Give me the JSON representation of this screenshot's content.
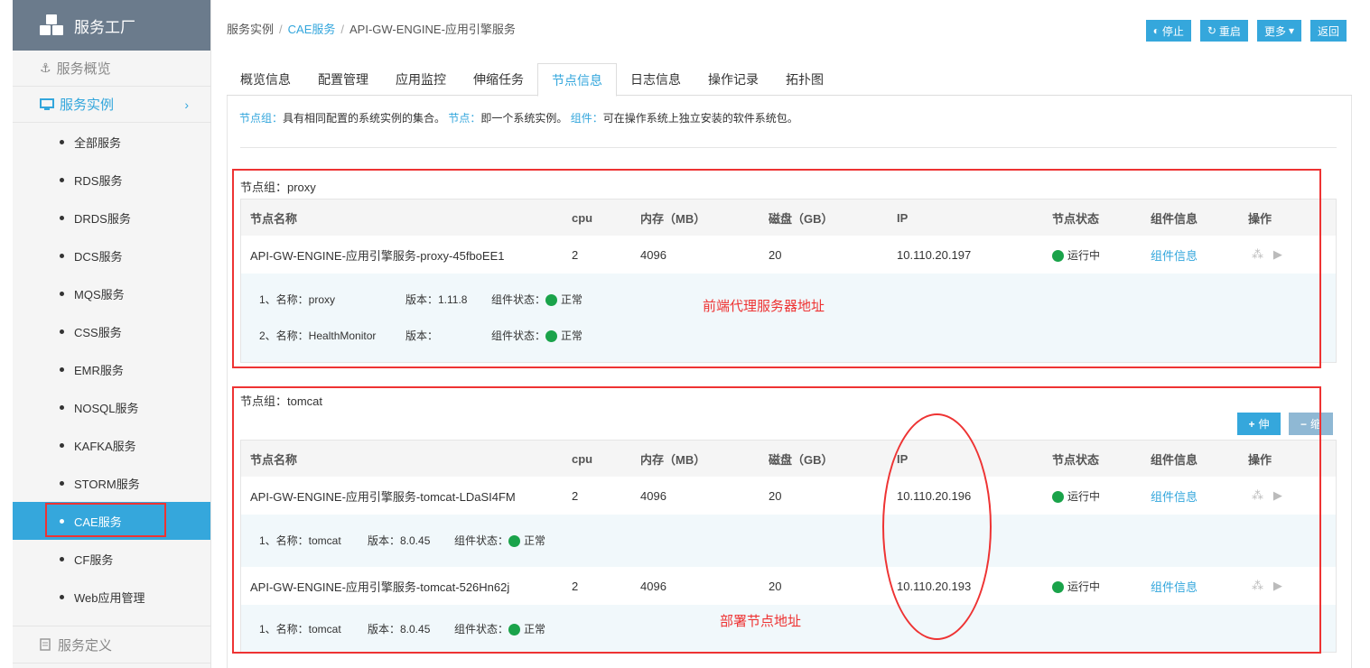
{
  "sidebar": {
    "brand": "服务工厂",
    "overview": "服务概览",
    "instances": "服务实例",
    "items": [
      "全部服务",
      "RDS服务",
      "DRDS服务",
      "DCS服务",
      "MQS服务",
      "CSS服务",
      "EMR服务",
      "NOSQL服务",
      "KAFKA服务",
      "STORM服务",
      "CAE服务",
      "CF服务",
      "Web应用管理"
    ],
    "active_index": 10,
    "definition": "服务定义"
  },
  "breadcrumb": {
    "root": "服务实例",
    "mid": "CAE服务",
    "current": "API-GW-ENGINE-应用引擎服务"
  },
  "buttons": {
    "stop": "停止",
    "restart": "重启",
    "more": "更多",
    "back": "返回"
  },
  "tabs": [
    "概览信息",
    "配置管理",
    "应用监控",
    "伸缩任务",
    "节点信息",
    "日志信息",
    "操作记录",
    "拓扑图"
  ],
  "active_tab": 4,
  "intro": {
    "k1": "节点组：",
    "t1": "具有相同配置的系统实例的集合。",
    "k2": "节点：",
    "t2": "即一个系统实例。",
    "k3": "组件：",
    "t3": "可在操作系统上独立安装的软件系统包。"
  },
  "table_headers": [
    "节点名称",
    "cpu",
    "内存（MB）",
    "磁盘（GB）",
    "IP",
    "节点状态",
    "组件信息",
    "操作"
  ],
  "groups": [
    {
      "title": "节点组：proxy",
      "nodes": [
        {
          "name": "API-GW-ENGINE-应用引擎服务-proxy-45fboEE1",
          "cpu": "2",
          "mem": "4096",
          "disk": "20",
          "ip": "10.110.20.197",
          "status": "运行中",
          "info": "组件信息"
        }
      ],
      "components": [
        {
          "name": "1、名称：proxy",
          "version": "版本：1.11.8",
          "state_label": "组件状态：",
          "state": "正常"
        },
        {
          "name": "2、名称：HealthMonitor",
          "version": "版本：",
          "state_label": "组件状态：",
          "state": "正常"
        }
      ]
    },
    {
      "title": "节点组：tomcat",
      "scale_out": "伸",
      "scale_in": "缩",
      "nodes": [
        {
          "name": "API-GW-ENGINE-应用引擎服务-tomcat-LDaSI4FM",
          "cpu": "2",
          "mem": "4096",
          "disk": "20",
          "ip": "10.110.20.196",
          "status": "运行中",
          "info": "组件信息",
          "component": {
            "name": "1、名称：tomcat",
            "version": "版本：8.0.45",
            "state_label": "组件状态：",
            "state": "正常"
          }
        },
        {
          "name": "API-GW-ENGINE-应用引擎服务-tomcat-526Hn62j",
          "cpu": "2",
          "mem": "4096",
          "disk": "20",
          "ip": "10.110.20.193",
          "status": "运行中",
          "info": "组件信息",
          "component": {
            "name": "1、名称：tomcat",
            "version": "版本：8.0.45",
            "state_label": "组件状态：",
            "state": "正常"
          }
        }
      ]
    }
  ],
  "annotations": {
    "proxy_note": "前端代理服务器地址",
    "tomcat_note": "部署节点地址"
  },
  "colors": {
    "accent": "#35a7dc",
    "brand_bg": "#6b7b8c",
    "status_ok": "#1aa34a",
    "annotation": "#e33333"
  }
}
